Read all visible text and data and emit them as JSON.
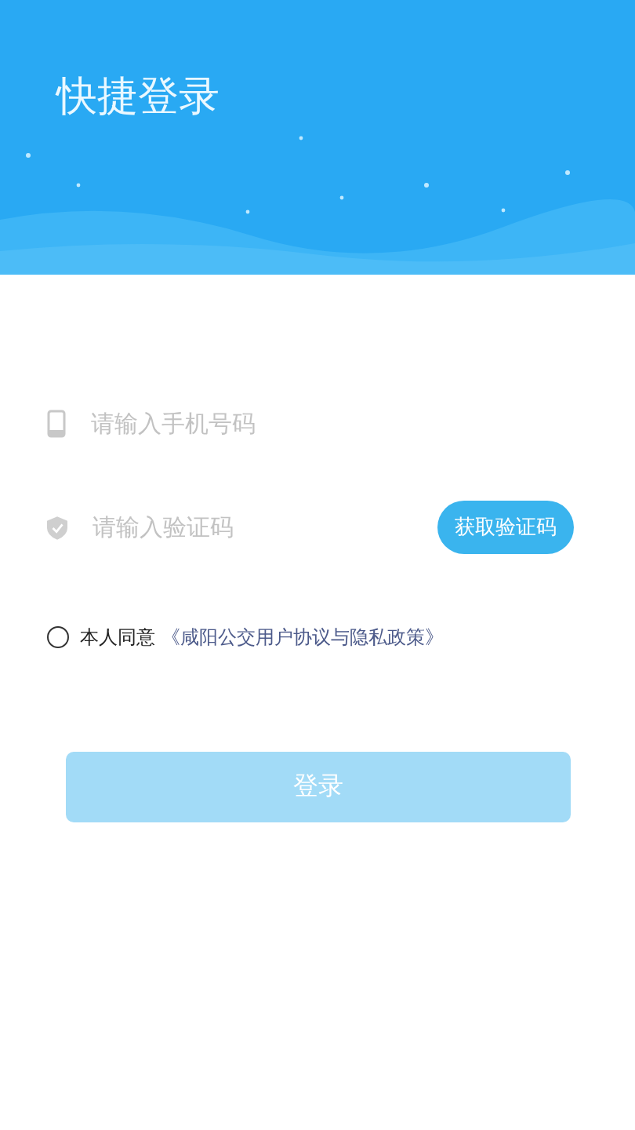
{
  "header": {
    "title": "快捷登录"
  },
  "phone_field": {
    "placeholder": "请输入手机号码"
  },
  "code_field": {
    "placeholder": "请输入验证码"
  },
  "get_code_button": {
    "label": "获取验证码"
  },
  "agreement": {
    "checked": false,
    "text": "本人同意",
    "link": "《咸阳公交用户协议与隐私政策》"
  },
  "login_button": {
    "label": "登录",
    "disabled": true
  }
}
